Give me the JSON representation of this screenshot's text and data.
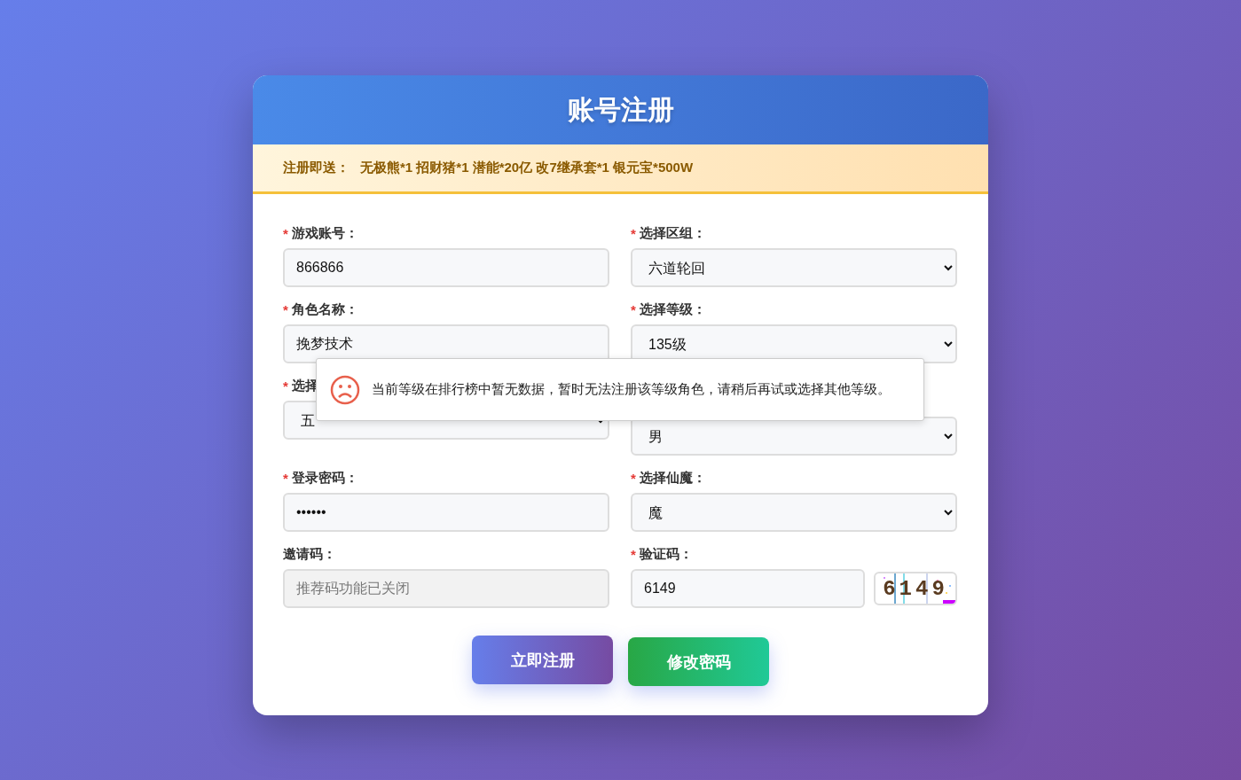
{
  "title": "账号注册",
  "notice": {
    "label": "注册即送：",
    "text": "无极熊*1 招财猪*1 潜能*20亿 改7继承套*1 银元宝*500W"
  },
  "fields": [
    {
      "kind": "input",
      "label": "游戏账号：",
      "mark": "*",
      "value": "866866"
    },
    {
      "kind": "select",
      "label": "选择区组：",
      "mark": "*",
      "value": "六道轮回"
    },
    {
      "kind": "input",
      "label": "角色名称：",
      "mark": "*",
      "value": "挽梦技术"
    },
    {
      "kind": "select",
      "label": "选择等级：",
      "mark": "*",
      "value": "135级"
    },
    {
      "kind": "select",
      "label": "选择",
      "mark": "*",
      "value": "五"
    },
    {
      "kind": "select",
      "value": "男"
    },
    {
      "kind": "input",
      "label": "登录密码：",
      "mark": "*",
      "value": "••••••"
    },
    {
      "kind": "select",
      "label": "选择仙魔：",
      "mark": "*",
      "value": "魔"
    },
    {
      "kind": "input",
      "label": "邀请码：",
      "placeholder": "推荐码功能已关闭",
      "disabled": true
    },
    {
      "kind": "captcha",
      "label": "验证码：",
      "mark": "*",
      "value": "6149",
      "code": "6149"
    }
  ],
  "buttons": [
    {
      "label": "立即注册",
      "kind": "primary"
    },
    {
      "label": "修改密码",
      "kind": "success"
    }
  ],
  "toast": {
    "text": "当前等级在排行榜中暂无数据，暂时无法注册该等级角色，请稍后再试或选择其他等级。"
  }
}
